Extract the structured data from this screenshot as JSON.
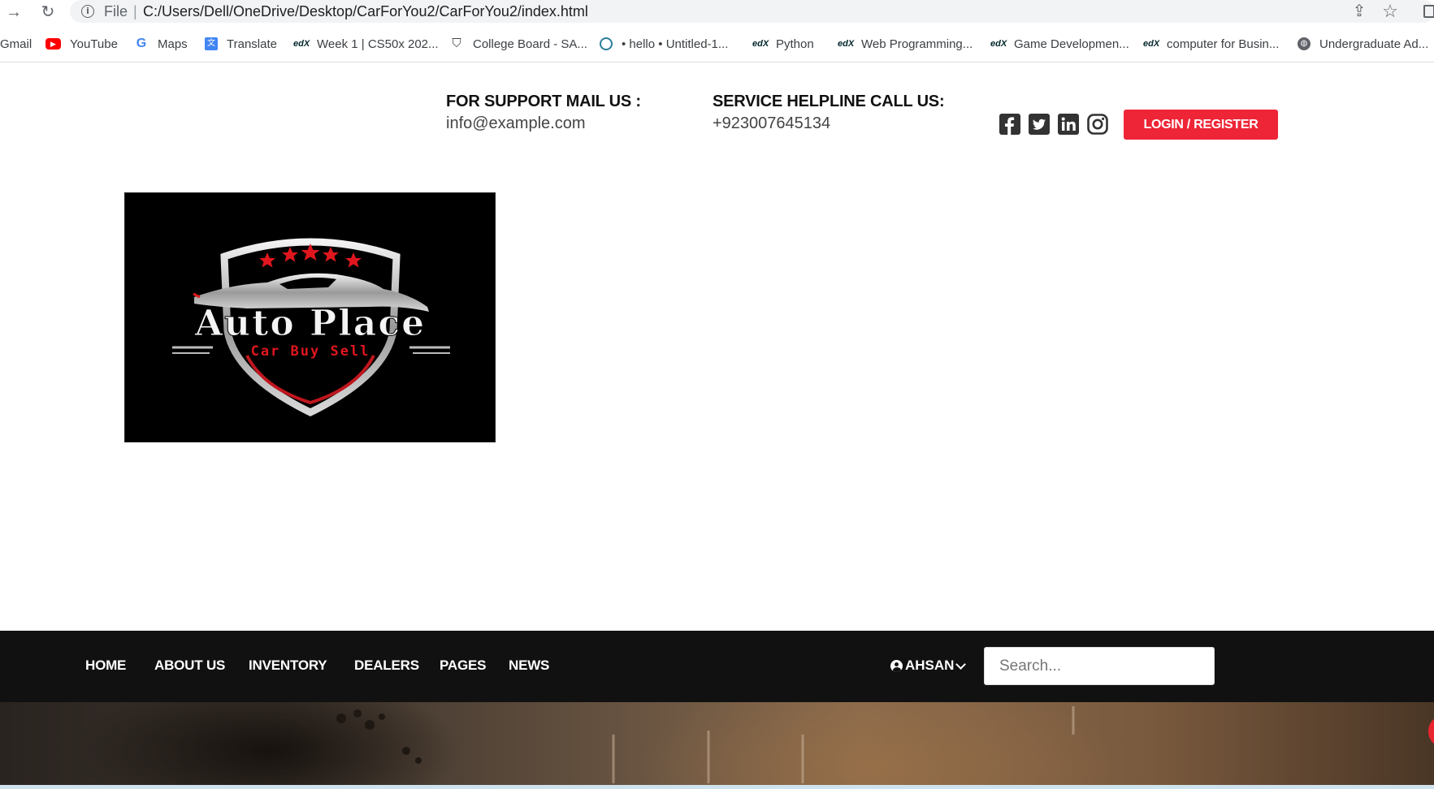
{
  "browser": {
    "scheme": "File",
    "url": "C:/Users/Dell/OneDrive/Desktop/CarForYou2/CarForYou2/index.html",
    "bookmarks": [
      {
        "label": "Gmail",
        "icon": "gmail-icon"
      },
      {
        "label": "YouTube",
        "icon": "youtube-icon"
      },
      {
        "label": "Maps",
        "icon": "google-icon"
      },
      {
        "label": "Translate",
        "icon": "translate-icon"
      },
      {
        "label": "Week 1 | CS50x 202...",
        "icon": "edx-icon"
      },
      {
        "label": "College Board - SA...",
        "icon": "shield-icon"
      },
      {
        "label": "• hello • Untitled-1...",
        "icon": "vscode-icon"
      },
      {
        "label": "Python",
        "icon": "edx-icon"
      },
      {
        "label": "Web Programming...",
        "icon": "edx-icon"
      },
      {
        "label": "Game Developmen...",
        "icon": "edx-icon"
      },
      {
        "label": "computer for Busin...",
        "icon": "edx-icon"
      },
      {
        "label": "Undergraduate Ad...",
        "icon": "globe-icon"
      }
    ]
  },
  "header": {
    "support_label": "FOR SUPPORT MAIL US :",
    "support_email": "info@example.com",
    "helpline_label": "SERVICE HELPLINE CALL US:",
    "helpline_phone": "+923007645134",
    "social": [
      "facebook-icon",
      "twitter-icon",
      "linkedin-icon",
      "instagram-icon"
    ],
    "login_label": "LOGIN / REGISTER",
    "accent_color": "#ee2537"
  },
  "logo": {
    "title": "Auto Place",
    "subtitle": "Car Buy Sell"
  },
  "nav": {
    "items": [
      "HOME",
      "ABOUT US",
      "INVENTORY",
      "DEALERS",
      "PAGES",
      "NEWS"
    ],
    "user_name": "AHSAN",
    "search_placeholder": "Search..."
  }
}
